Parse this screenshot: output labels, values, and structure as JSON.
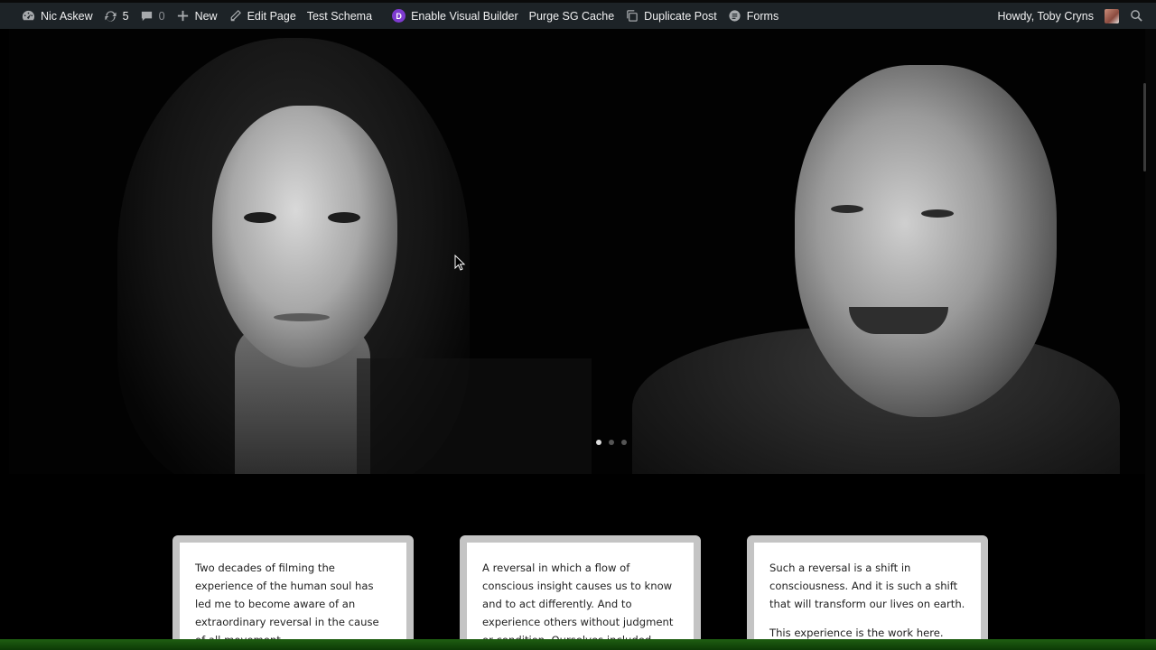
{
  "adminbar": {
    "site_name": "Nic Askew",
    "updates_count": "5",
    "comments_count": "0",
    "new_label": "New",
    "edit_page_label": "Edit Page",
    "test_schema_label": "Test Schema",
    "divi_badge": "D",
    "visual_builder_label": "Enable Visual Builder",
    "purge_cache_label": "Purge SG Cache",
    "duplicate_post_label": "Duplicate Post",
    "forms_label": "Forms",
    "greeting": "Howdy, Toby Cryns"
  },
  "slider": {
    "dot_count": 3,
    "active_dot": 1
  },
  "cards": [
    {
      "paragraphs": [
        "Two decades of filming the experience of the human soul has led me to become aware of an extraordinary reversal in the cause of all movement."
      ]
    },
    {
      "paragraphs": [
        "A reversal in which a flow of conscious insight causes us to know and to act differently. And to experience others without judgment or condition. Ourselves included."
      ]
    },
    {
      "paragraphs": [
        "Such a reversal is a shift in consciousness. And it is such a shift that will transform our lives on earth.",
        "This experience is the work here."
      ]
    }
  ],
  "colors": {
    "adminbar_bg": "#1d2327",
    "divi_purple": "#7e3bd0",
    "card_frame": "#c4c4c4",
    "bottom_bar": "#1f5e12"
  }
}
